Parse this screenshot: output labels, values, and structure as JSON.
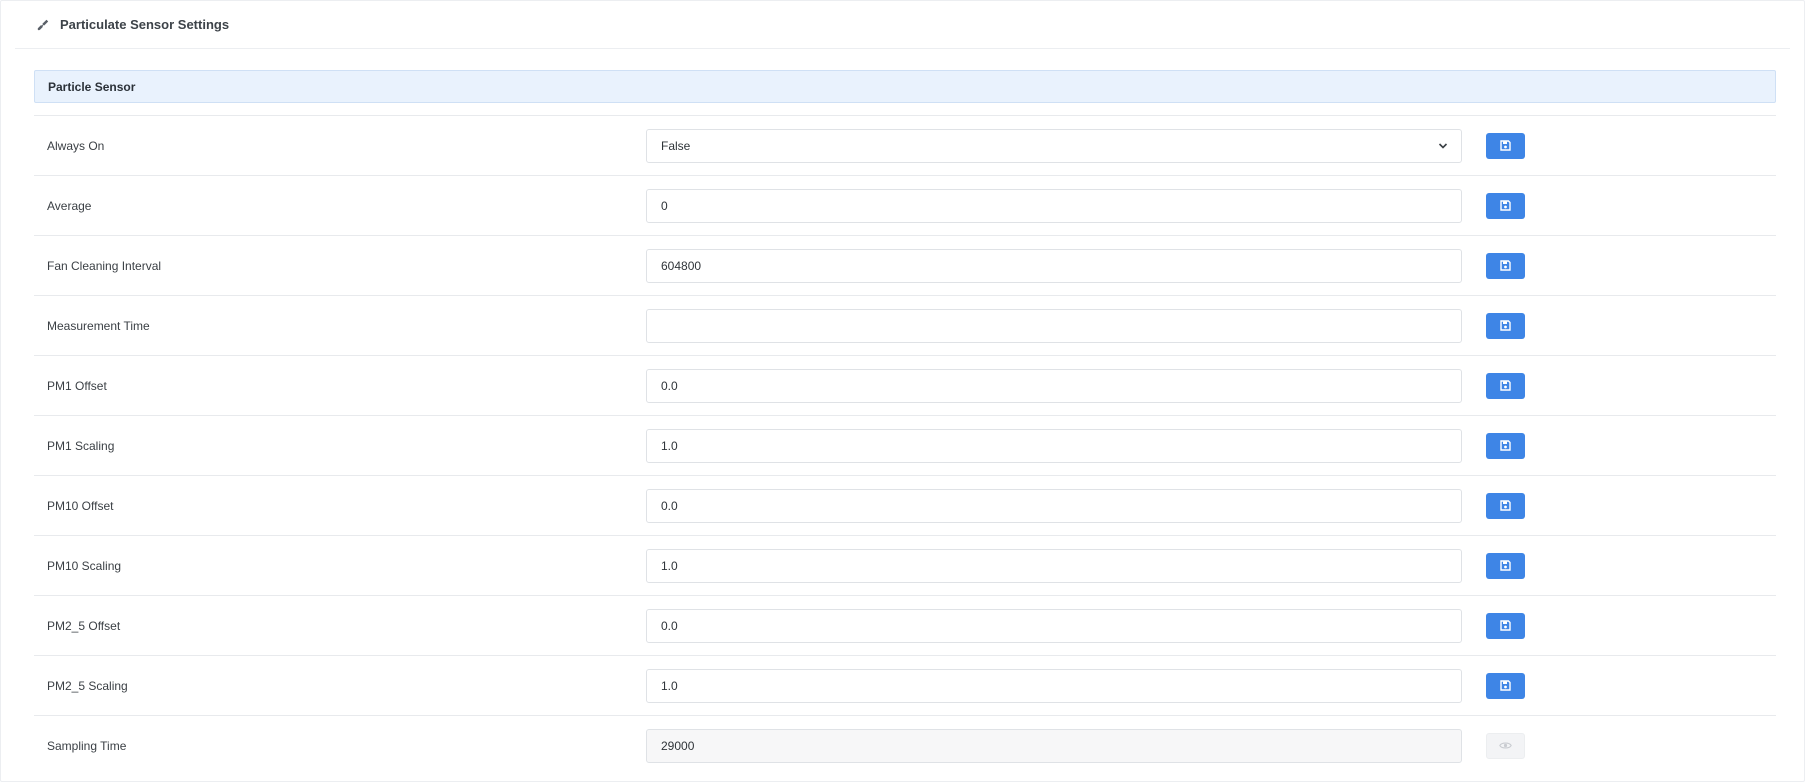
{
  "header": {
    "title": "Particulate Sensor Settings",
    "icon": "wrench-icon"
  },
  "section": {
    "title": "Particle Sensor"
  },
  "colors": {
    "accent": "#3e85e6",
    "section_bg": "#e9f2fd"
  },
  "settings": [
    {
      "key": "always_on",
      "label": "Always On",
      "type": "select",
      "value": "False",
      "action": "save"
    },
    {
      "key": "average",
      "label": "Average",
      "type": "input",
      "value": "0",
      "action": "save"
    },
    {
      "key": "fan_cleaning_interval",
      "label": "Fan Cleaning Interval",
      "type": "input",
      "value": "604800",
      "action": "save"
    },
    {
      "key": "measurement_time",
      "label": "Measurement Time",
      "type": "input",
      "value": "",
      "action": "save"
    },
    {
      "key": "pm1_offset",
      "label": "PM1 Offset",
      "type": "input",
      "value": "0.0",
      "action": "save"
    },
    {
      "key": "pm1_scaling",
      "label": "PM1 Scaling",
      "type": "input",
      "value": "1.0",
      "action": "save"
    },
    {
      "key": "pm10_offset",
      "label": "PM10 Offset",
      "type": "input",
      "value": "0.0",
      "action": "save"
    },
    {
      "key": "pm10_scaling",
      "label": "PM10 Scaling",
      "type": "input",
      "value": "1.0",
      "action": "save"
    },
    {
      "key": "pm2_5_offset",
      "label": "PM2_5 Offset",
      "type": "input",
      "value": "0.0",
      "action": "save"
    },
    {
      "key": "pm2_5_scaling",
      "label": "PM2_5 Scaling",
      "type": "input",
      "value": "1.0",
      "action": "save"
    },
    {
      "key": "sampling_time",
      "label": "Sampling Time",
      "type": "readonly",
      "value": "29000",
      "action": "view"
    }
  ]
}
